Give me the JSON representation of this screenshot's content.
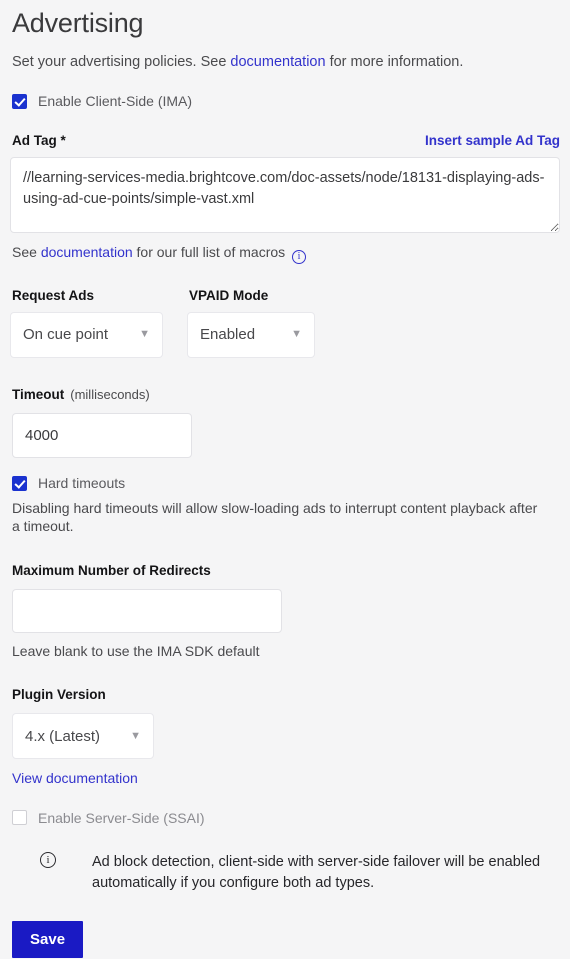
{
  "page": {
    "title": "Advertising",
    "intro_before": "Set your advertising policies. See ",
    "intro_link": "documentation",
    "intro_after": " for more information."
  },
  "client_side": {
    "checkbox_label": "Enable Client-Side (IMA)",
    "checked": true
  },
  "ad_tag": {
    "label": "Ad Tag *",
    "insert_sample_link": "Insert sample Ad Tag",
    "value": "//learning-services-media.brightcove.com/doc-assets/node/18131-displaying-ads-using-ad-cue-points/simple-vast.xml",
    "placeholder": "",
    "helper_before": "See ",
    "helper_link": "documentation",
    "helper_after": " for our full list of macros ",
    "helper_icon": "info-icon"
  },
  "request_ads": {
    "label": "Request Ads",
    "value": "On cue point",
    "options": [
      "On cue point"
    ]
  },
  "vpaid_mode": {
    "label": "VPAID Mode",
    "value": "Enabled",
    "options": [
      "Enabled"
    ]
  },
  "timeout": {
    "label": "Timeout",
    "unit": "(milliseconds)",
    "value": "4000",
    "placeholder": ""
  },
  "hard_timeouts": {
    "checkbox_label": "Hard timeouts",
    "checked": true,
    "description": "Disabling hard timeouts will allow slow-loading ads to interrupt content playback after a timeout."
  },
  "max_redirects": {
    "label": "Maximum Number of Redirects",
    "value": "",
    "placeholder": "",
    "helper": "Leave blank to use the IMA SDK default"
  },
  "plugin_version": {
    "label": "Plugin Version",
    "value": "4.x (Latest)",
    "options": [
      "4.x (Latest)"
    ],
    "doc_link": "View documentation"
  },
  "server_side": {
    "checkbox_label": "Enable Server-Side (SSAI)",
    "checked": false
  },
  "notice": {
    "icon": "info-icon",
    "message": "Ad block detection, client-side with server-side failover will be enabled automatically if you configure both ad types."
  },
  "actions": {
    "save_label": "Save"
  },
  "colors": {
    "accent_blue": "#1a32cf",
    "link_blue": "#3333cc",
    "save_blue": "#1a1ac4",
    "page_bg": "#f5f5f6",
    "field_bg": "#ffffff"
  }
}
